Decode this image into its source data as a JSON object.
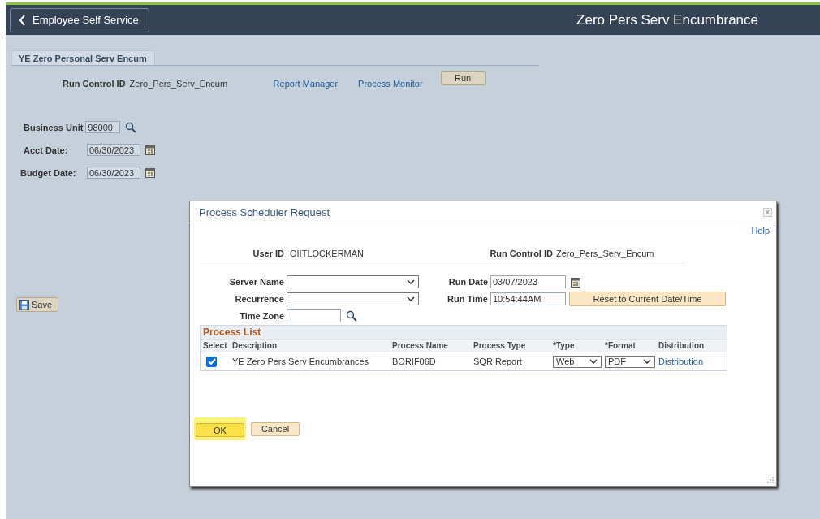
{
  "header": {
    "back_button": "Employee Self Service",
    "title": "Zero Pers Serv Encumbrance"
  },
  "tab": {
    "label": "YE Zero Personal Serv Encum",
    "selected": true
  },
  "run_control": {
    "label": "Run Control ID",
    "value": "Zero_Pers_Serv_Encum"
  },
  "links": [
    "Report Manager",
    "Process Monitor"
  ],
  "run_button": "Run",
  "fields": [
    {
      "label": "Business Unit",
      "value": "98000",
      "kind": "lookup"
    },
    {
      "label": "Acct Date:",
      "value": "06/30/2023",
      "kind": "date"
    },
    {
      "label": "Budget Date:",
      "value": "06/30/2023",
      "kind": "date"
    }
  ],
  "save_button": "Save",
  "dialog": {
    "title": "Process Scheduler Request",
    "close": "×",
    "help": "Help",
    "user_id": {
      "label": "User ID",
      "value": "OIITLOCKERMAN"
    },
    "run_control_id": {
      "label": "Run Control ID",
      "value": "Zero_Pers_Serv_Encum"
    },
    "server_name": {
      "label": "Server Name"
    },
    "recurrence": {
      "label": "Recurrence"
    },
    "time_zone": {
      "label": "Time Zone"
    },
    "run_date": {
      "label": "Run Date",
      "value": "03/07/2023"
    },
    "run_time": {
      "label": "Run Time",
      "value": "10:54:44AM"
    },
    "reset_button": "Reset to Current Date/Time",
    "process_list": {
      "title": "Process List",
      "columns": [
        "Select",
        "Description",
        "Process Name",
        "Process Type",
        "*Type",
        "*Format",
        "Distribution"
      ],
      "rows": [
        {
          "checked": true,
          "description": "YE Zero Pers Serv Encumbrances",
          "process_name": "BORIF06D",
          "process_type": "SQR Report",
          "type": "Web",
          "format": "PDF",
          "distribution": "Distribution"
        }
      ]
    },
    "ok_button": {
      "label": "OK",
      "highlighted": true
    },
    "cancel_button": "Cancel"
  }
}
